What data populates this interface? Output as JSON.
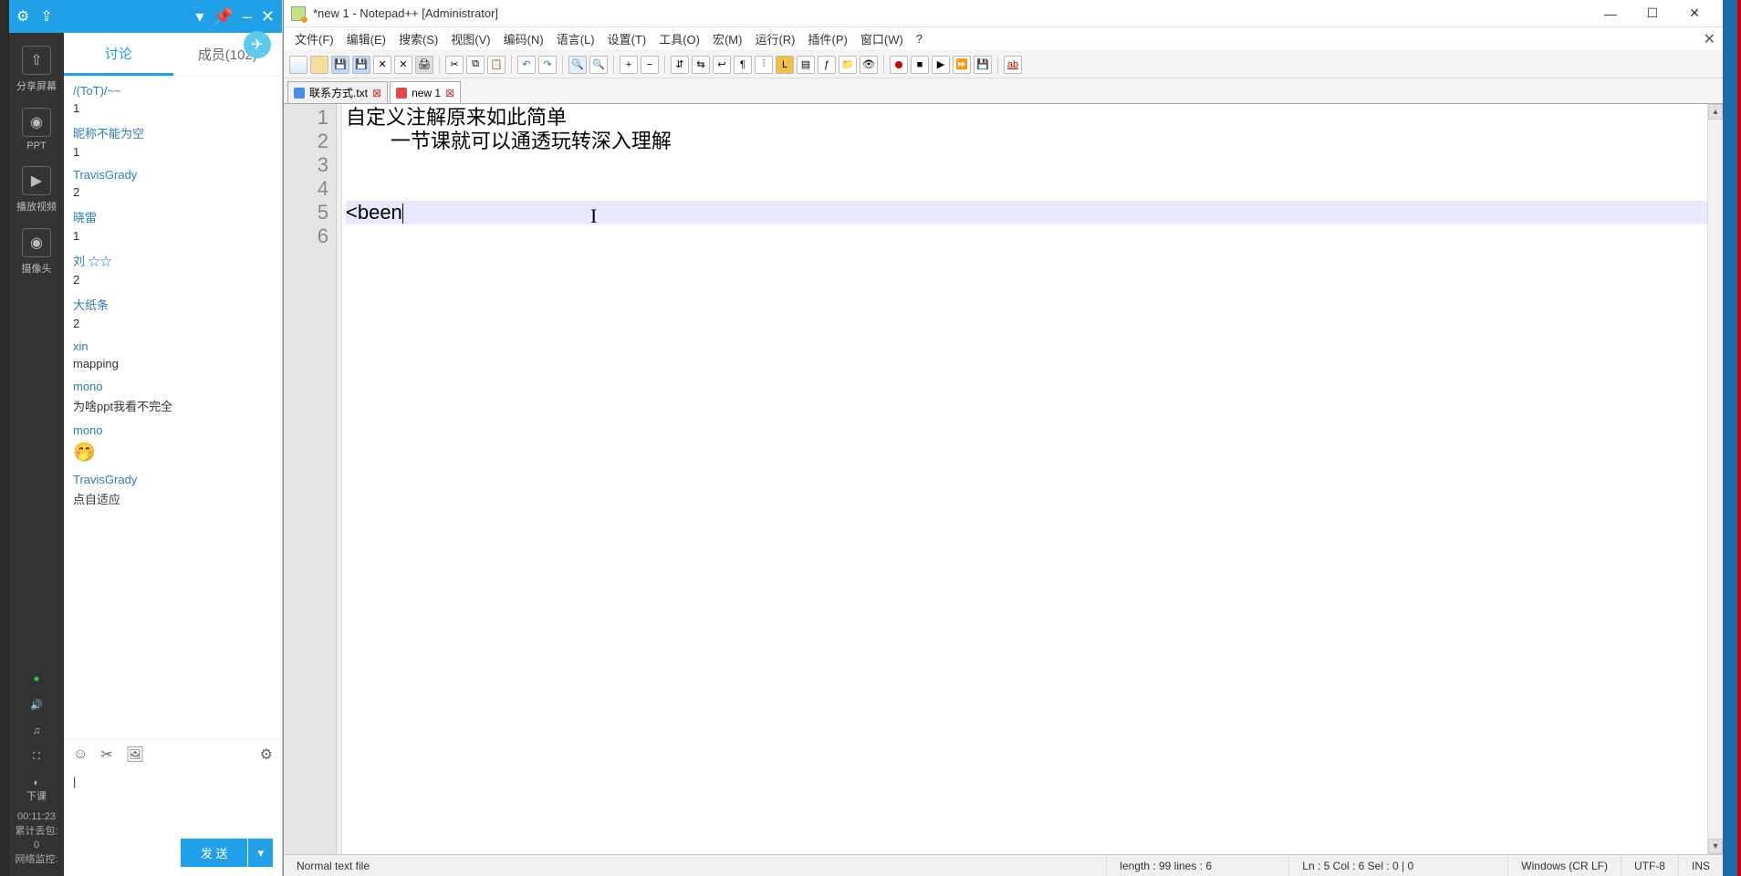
{
  "chat": {
    "titlebar": {
      "settings_icon": "⚙",
      "share_icon": "⇪",
      "dropdown_icon": "▾",
      "pin_icon": "📌",
      "minimize": "–",
      "close": "✕"
    },
    "tools": [
      {
        "icon": "⇧",
        "label": "分享屏幕"
      },
      {
        "icon": "◉",
        "label": "PPT"
      },
      {
        "icon": "▶",
        "label": "播放视频"
      },
      {
        "icon": "◉",
        "label": "摄像头"
      }
    ],
    "tool_status": [
      {
        "icon": "●",
        "color": "#3c3"
      },
      {
        "icon": "🔊",
        "color": "#ccc"
      },
      {
        "icon": "♫",
        "color": "#ccc"
      },
      {
        "icon": "⛶",
        "color": "#ccc"
      },
      {
        "icon": "◐",
        "color": "#ccc"
      }
    ],
    "tool_bottom_label": "下课",
    "stats": {
      "timer": "00:11:23",
      "line1": "累计丢包:",
      "line2": "0",
      "line3": "网络监控:"
    },
    "tabs": {
      "discussion": "讨论",
      "members": "成员(102)"
    },
    "messages": [
      {
        "user": "/(ToT)/~~",
        "body": "1"
      },
      {
        "user": "昵称不能为空",
        "body": "1"
      },
      {
        "user": "TravisGrady",
        "body": "2"
      },
      {
        "user": "晓雷",
        "body": "1"
      },
      {
        "user": "刘 ☆☆",
        "body": "2"
      },
      {
        "user": "大纸条",
        "body": "2"
      },
      {
        "user": "xin",
        "body": "mapping"
      },
      {
        "user": "mono",
        "body": "为啥ppt我看不完全"
      },
      {
        "user": "mono",
        "body": "🤭",
        "emoji": true
      },
      {
        "user": "TravisGrady",
        "body": "点自适应"
      }
    ],
    "input_icons": {
      "emoji": "☺",
      "scissors": "✂",
      "image": "🖼",
      "settings": "⚙"
    },
    "input_value": "|",
    "send_label": "发 送",
    "send_more": "▾"
  },
  "npp": {
    "title": "*new 1 - Notepad++ [Administrator]",
    "win_minimize": "—",
    "win_maximize": "☐",
    "win_close": "✕",
    "menu": [
      "文件(F)",
      "编辑(E)",
      "搜索(S)",
      "视图(V)",
      "编码(N)",
      "语言(L)",
      "设置(T)",
      "工具(O)",
      "宏(M)",
      "运行(R)",
      "插件(P)",
      "窗口(W)",
      "?"
    ],
    "menu_close": "✕",
    "tabs": [
      {
        "label": "联系方式.txt",
        "saved": true
      },
      {
        "label": "new 1",
        "saved": false
      }
    ],
    "tab_close": "⊠",
    "code": {
      "lines": [
        "1",
        "2",
        "3",
        "4",
        "5",
        "6"
      ],
      "l1": "自定义注解原来如此简单",
      "l2": "\t一节课就可以通透玩转深入理解",
      "l3": "",
      "l4": "",
      "l5": "<been",
      "l6": ""
    },
    "scroll_up": "▴",
    "scroll_down": "▾",
    "status": {
      "filetype": "Normal text file",
      "length": "length : 99    lines : 6",
      "pos": "Ln : 5    Col : 6    Sel : 0 | 0",
      "eol": "Windows (CR LF)",
      "enc": "UTF-8",
      "ins": "INS"
    }
  }
}
